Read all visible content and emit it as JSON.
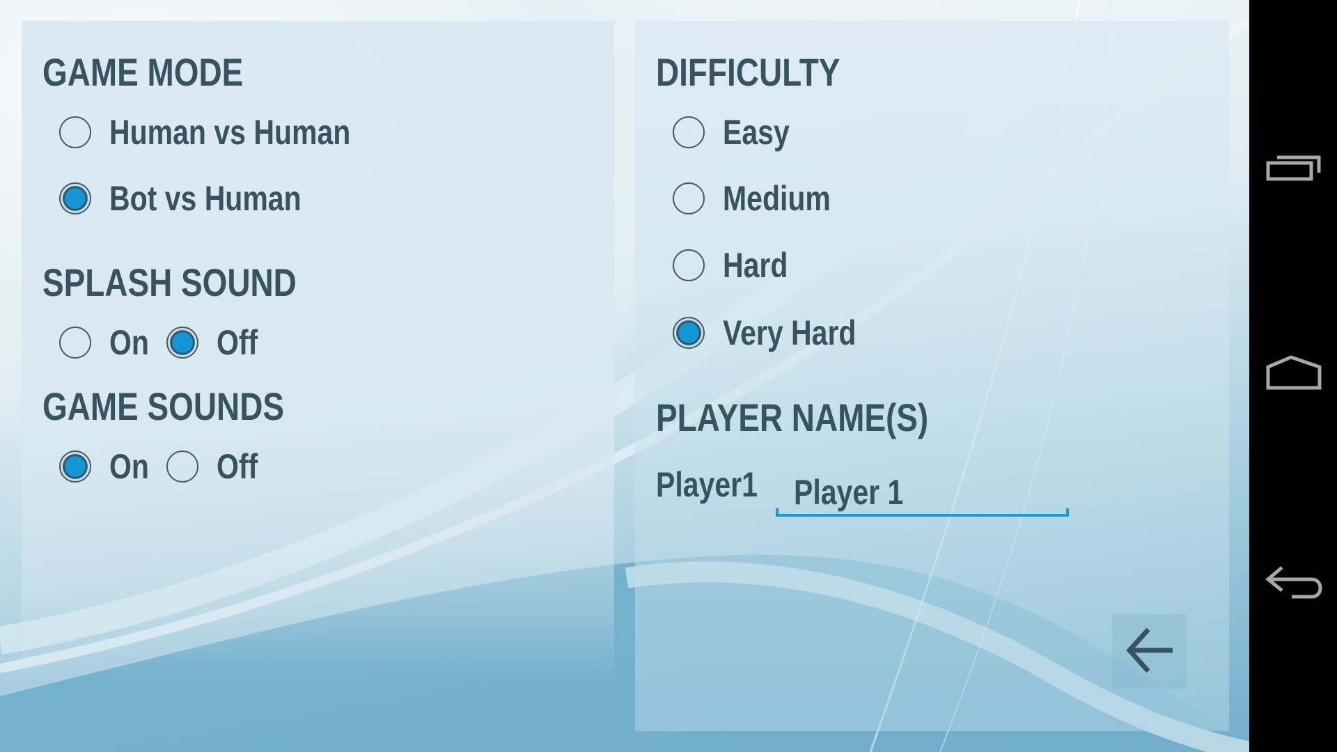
{
  "game_mode": {
    "title": "GAME MODE",
    "options": [
      {
        "label": "Human vs Human",
        "checked": false
      },
      {
        "label": "Bot vs Human",
        "checked": true
      }
    ]
  },
  "splash_sound": {
    "title": "SPLASH SOUND",
    "options": [
      {
        "label": "On",
        "checked": false
      },
      {
        "label": "Off",
        "checked": true
      }
    ]
  },
  "game_sounds": {
    "title": "GAME SOUNDS",
    "options": [
      {
        "label": "On",
        "checked": true
      },
      {
        "label": "Off",
        "checked": false
      }
    ]
  },
  "difficulty": {
    "title": "DIFFICULTY",
    "options": [
      {
        "label": "Easy",
        "checked": false
      },
      {
        "label": "Medium",
        "checked": false
      },
      {
        "label": "Hard",
        "checked": false
      },
      {
        "label": "Very Hard",
        "checked": true
      }
    ]
  },
  "player_names": {
    "title": "PLAYER NAME(S)",
    "players": [
      {
        "label": "Player1",
        "value": "Player 1"
      }
    ]
  },
  "back_button": {
    "icon": "arrow-left-icon"
  },
  "navbar": {
    "buttons": [
      {
        "name": "recent-apps",
        "icon": "recent-apps-icon"
      },
      {
        "name": "home",
        "icon": "home-icon"
      },
      {
        "name": "back",
        "icon": "back-icon"
      }
    ]
  },
  "colors": {
    "text": "#37535f",
    "accent": "#1a9ad6",
    "navbar": "#000000",
    "nav_icon": "#a8a8a8"
  }
}
